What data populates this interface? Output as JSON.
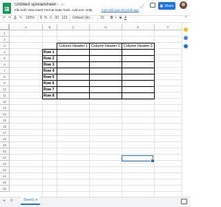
{
  "app": {
    "doc_title": "Untitled spreadsheet",
    "menu": [
      "File",
      "Edit",
      "View",
      "Insert",
      "Format",
      "Data",
      "Tools",
      "Add-ons",
      "Help"
    ],
    "last_edit": "Last edit was seconds ago",
    "share_label": "Share"
  },
  "toolbar": {
    "zoom": "100%",
    "currency": "$",
    "percent": "%",
    "decimal_dec": ".0",
    "decimal_inc": ".00",
    "more_formats": "123",
    "font": "Default (Ari...",
    "font_size": "10"
  },
  "grid": {
    "columns": [
      "A",
      "B",
      "C",
      "D",
      "E",
      "F"
    ],
    "rows": [
      "1",
      "2",
      "3",
      "4",
      "5",
      "6",
      "7",
      "8",
      "9",
      "10",
      "11",
      "12",
      "13",
      "14",
      "15",
      "16",
      "17",
      "18",
      "19",
      "20",
      "21",
      "22",
      "23",
      "24",
      "25",
      "26"
    ]
  },
  "table": {
    "headers": [
      "Column Header 1",
      "Column Header 2",
      "Column Header 3"
    ],
    "row_labels": [
      "Row 1",
      "Row 2",
      "Row 3",
      "Row 4",
      "Row 5",
      "Row 6",
      "Row 7",
      "Row 8"
    ]
  },
  "sheets": {
    "tabs": [
      "Sheet1"
    ]
  },
  "colors": {
    "brand": "#0f9d58",
    "accent": "#1a73e8",
    "grid_line": "#e2e2e2",
    "header_bg": "#f8f9fa"
  },
  "icons": [
    "sheets-logo-icon",
    "star-icon",
    "folder-icon",
    "activity-icon",
    "comment-icon",
    "lock-icon",
    "undo-icon",
    "redo-icon",
    "print-icon",
    "paint-format-icon",
    "add-sheet-icon",
    "sheets-list-icon",
    "explore-icon"
  ]
}
